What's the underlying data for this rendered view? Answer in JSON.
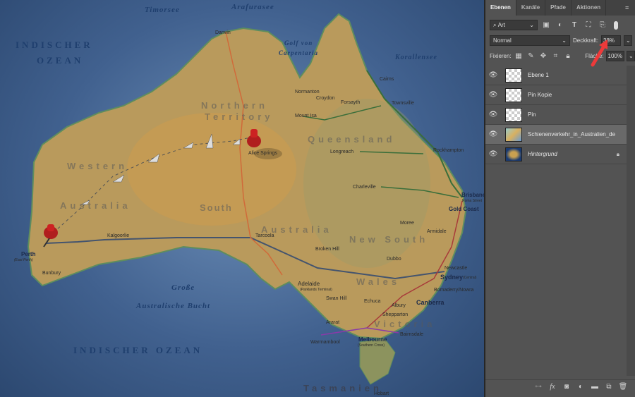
{
  "map": {
    "seas": [
      "Timorsee",
      "Arafurasee",
      "INDISCHER",
      "OZEAN",
      "Golf von",
      "Carpentaria",
      "Korallensee",
      "Große",
      "Australische Bucht",
      "INDISCHER OZEAN",
      "Tasmanien"
    ],
    "states": [
      "Northern",
      "Territory",
      "Queensland",
      "Western",
      "Australia",
      "South",
      "Australia",
      "New South",
      "Wales",
      "Victoria"
    ],
    "cities": [
      "Darwin",
      "Cairns",
      "Normanton",
      "Croydon",
      "Forsayth",
      "Townsville",
      "Mount Isa",
      "Longreach",
      "Rockhampton",
      "Charleville",
      "Brisbane",
      "Roma Street",
      "Gold Coast",
      "Alice Springs",
      "Kalgoorlie",
      "Tarcoola",
      "Perth",
      "(East Perth)",
      "Bunbury",
      "Moree",
      "Armidale",
      "Broken Hill",
      "Dubbo",
      "Newcastle",
      "Sydney",
      "(Central)",
      "Bomaderry/Nowra",
      "Canberra",
      "Adelaide",
      "(Parklands Terminal)",
      "Swan Hill",
      "Echuca",
      "Albury",
      "Shepparton",
      "Ararat",
      "Warrnambool",
      "Melbourne",
      "(Southern Cross)",
      "Bairnsdale",
      "Hobart"
    ]
  },
  "panel": {
    "tabs": [
      "Ebenen",
      "Kanäle",
      "Pfade",
      "Aktionen"
    ],
    "filter": "Art",
    "blend_mode": "Normal",
    "opacity_label": "Deckkraft:",
    "opacity_value": "38%",
    "lock_label": "Fixieren:",
    "fill_label": "Fläche:",
    "fill_value": "100%",
    "layers": [
      {
        "name": "Ebene 1"
      },
      {
        "name": "Pin Kopie"
      },
      {
        "name": "Pin"
      },
      {
        "name": "Schienenverkehr_in_Australien_de",
        "selected": true
      },
      {
        "name": "Hintergrund",
        "locked": true
      }
    ],
    "arrow_color": "#ee3a3a"
  }
}
